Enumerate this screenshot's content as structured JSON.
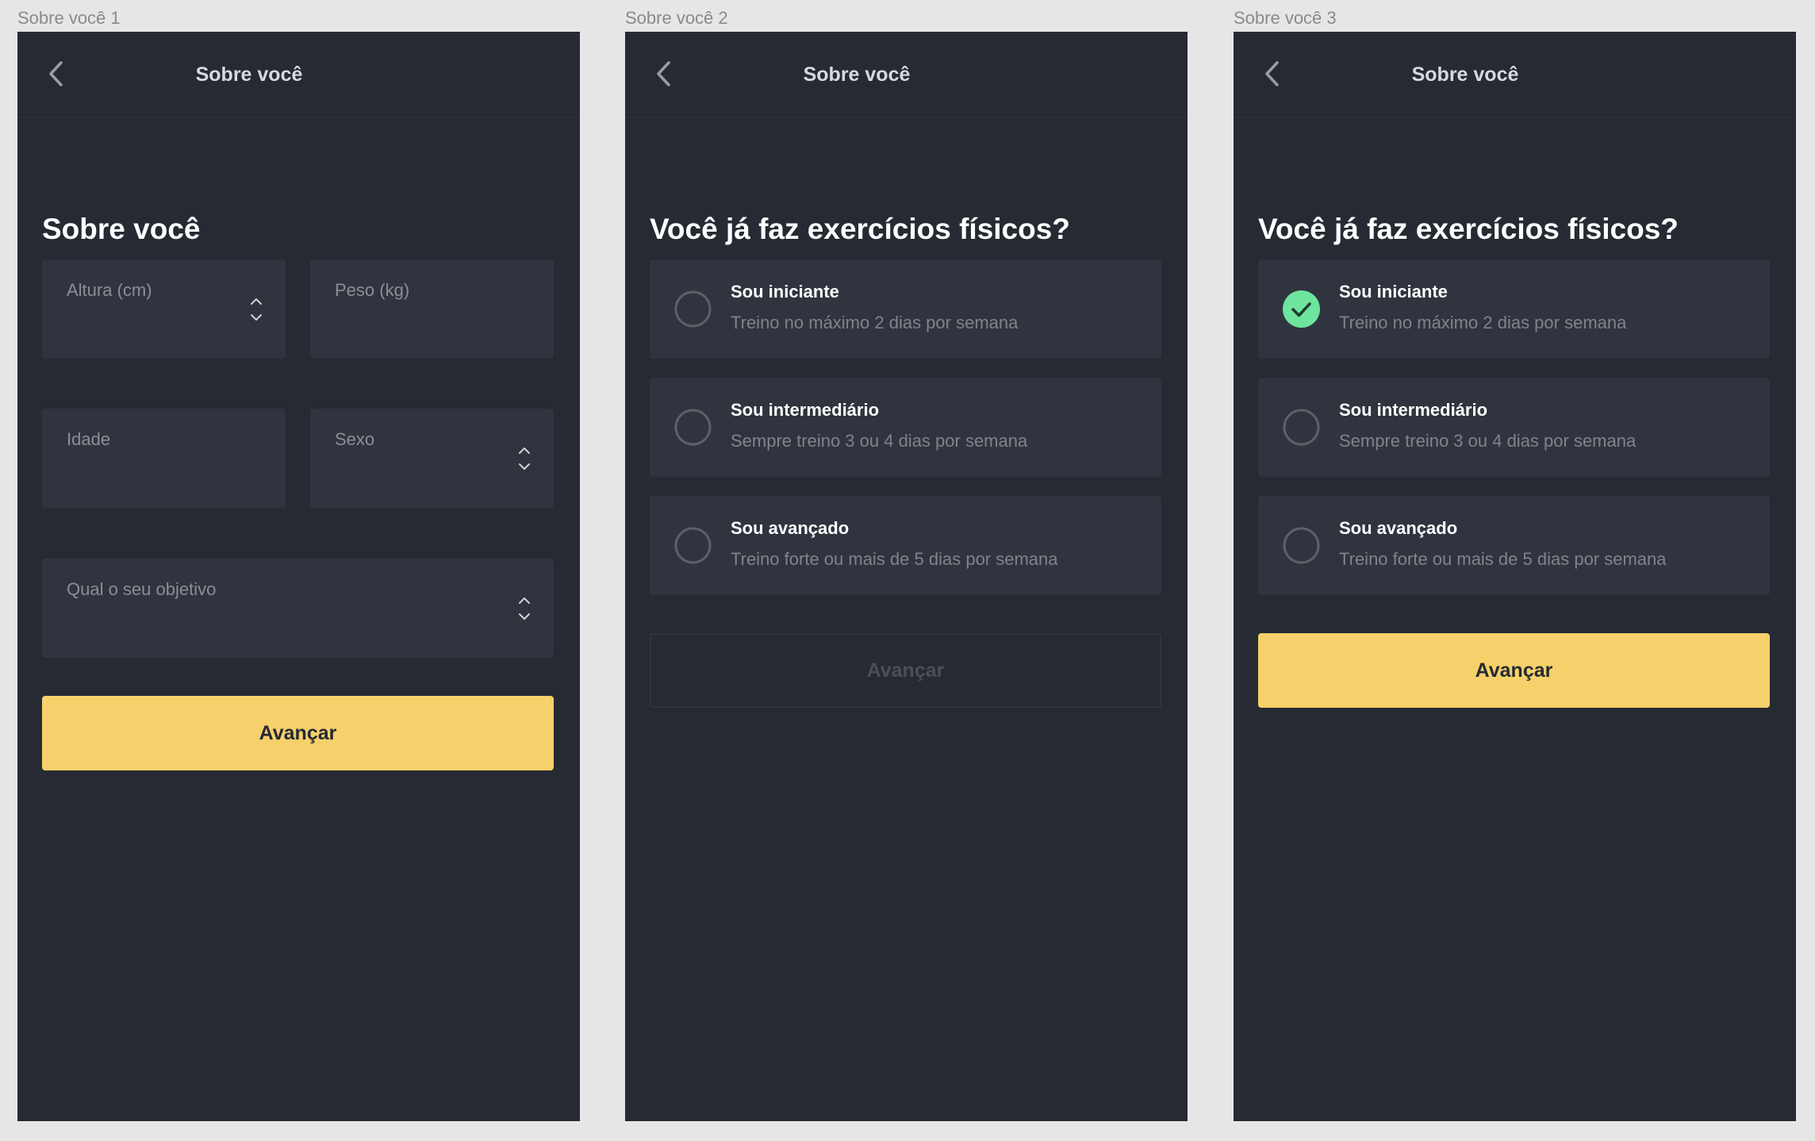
{
  "frames": [
    {
      "label": "Sobre você 1",
      "nav_title": "Sobre você",
      "heading": "Sobre você",
      "fields": {
        "altura": "Altura (cm)",
        "peso": "Peso (kg)",
        "idade": "Idade",
        "sexo": "Sexo",
        "objetivo": "Qual o seu objetivo"
      },
      "button": "Avançar"
    },
    {
      "label": "Sobre você 2",
      "nav_title": "Sobre você",
      "heading": "Você já faz exercícios físicos?",
      "options": [
        {
          "title": "Sou iniciante",
          "subtitle": "Treino no máximo 2 dias por semana",
          "selected": false
        },
        {
          "title": "Sou intermediário",
          "subtitle": "Sempre treino 3 ou 4 dias por semana",
          "selected": false
        },
        {
          "title": "Sou avançado",
          "subtitle": "Treino forte ou mais de 5 dias por semana",
          "selected": false
        }
      ],
      "button": "Avançar",
      "button_state": "disabled"
    },
    {
      "label": "Sobre você 3",
      "nav_title": "Sobre você",
      "heading": "Você já faz exercícios físicos?",
      "options": [
        {
          "title": "Sou iniciante",
          "subtitle": "Treino no máximo 2 dias por semana",
          "selected": true
        },
        {
          "title": "Sou intermediário",
          "subtitle": "Sempre treino 3 ou 4 dias por semana",
          "selected": false
        },
        {
          "title": "Sou avançado",
          "subtitle": "Treino forte ou mais de 5 dias por semana",
          "selected": false
        }
      ],
      "button": "Avançar",
      "button_state": "enabled"
    }
  ],
  "colors": {
    "canvas": "#e6e6e6",
    "screen_bg": "#262a33",
    "card_bg": "#30343e",
    "accent_yellow": "#f6d06a",
    "check_green": "#6ee59e"
  },
  "icons": [
    "chevron-left-icon",
    "stepper-icon",
    "radio-icon",
    "check-icon"
  ]
}
